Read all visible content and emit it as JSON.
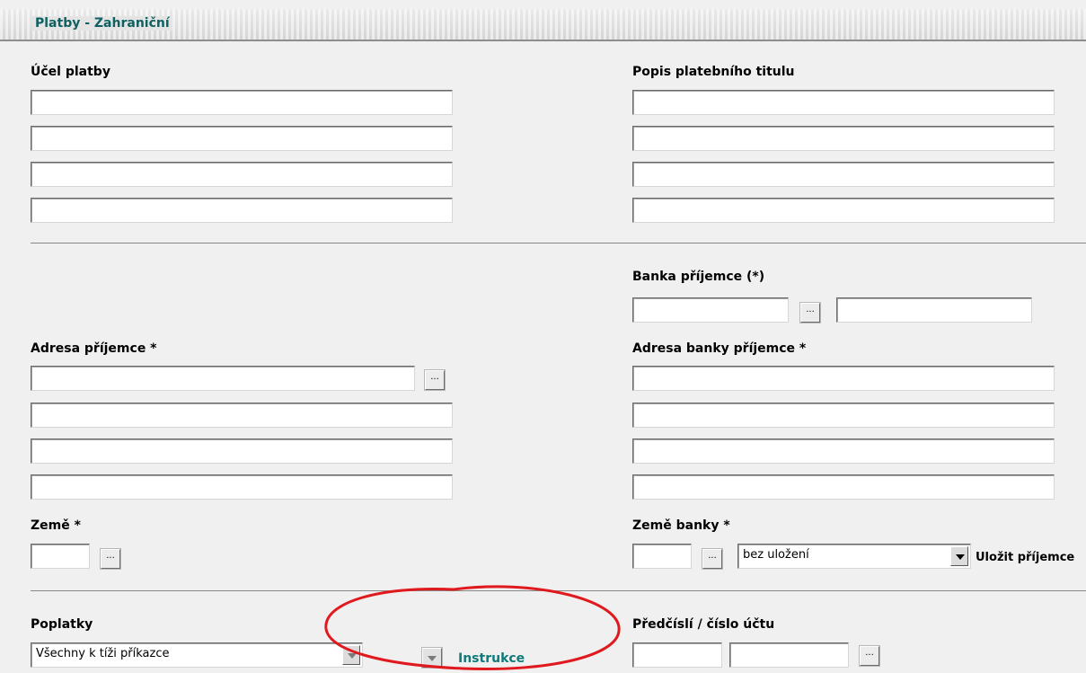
{
  "header": {
    "title": "Platby - Zahraniční"
  },
  "left": {
    "purpose_label": "Účel platby",
    "address_label": "Adresa příjemce *",
    "country_label": "Země *",
    "fees_label": "Poplatky",
    "fees_value": "Všechny k tíži příkazce",
    "instructions_link": "Instrukce"
  },
  "right": {
    "title_desc_label": "Popis platebního titulu",
    "bank_label": "Banka příjemce (*)",
    "bank_address_label": "Adresa banky příjemce *",
    "bank_country_label": "Země banky *",
    "save_select_value": "bez uložení",
    "save_recipient_label": "Uložit příjemce",
    "account_label": "Předčíslí / číslo účtu"
  },
  "buttons": {
    "ellipsis": "..."
  },
  "annotation": {
    "color": "#e0191e"
  }
}
